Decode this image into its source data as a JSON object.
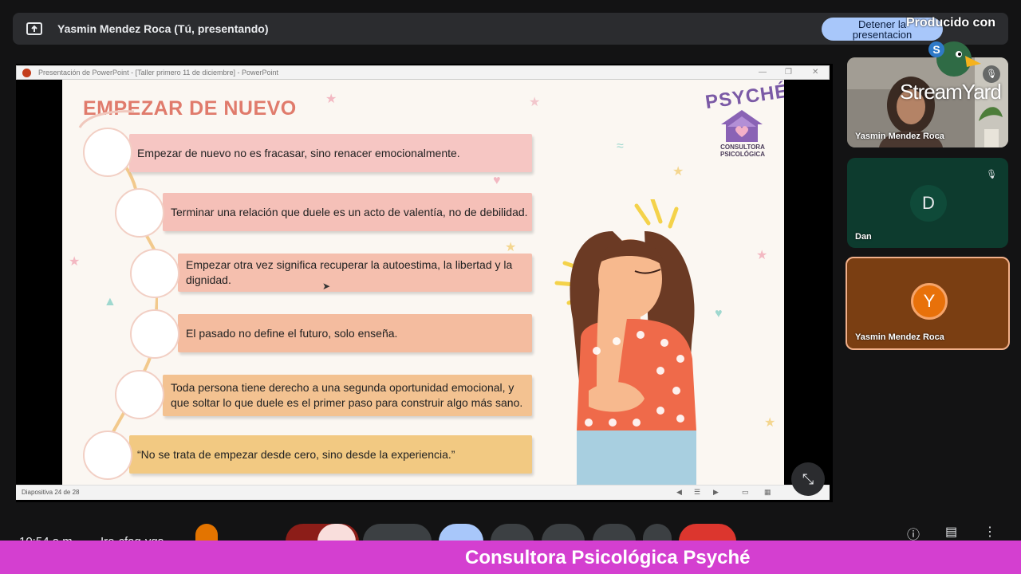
{
  "meet": {
    "presenting_title": "Yasmin Mendez Roca (Tú, presentando)",
    "stop_presenting_line1": "Detener la",
    "stop_presenting_line2": "presentacion",
    "meeting_code": "Iro-cfaq-yqs",
    "clock": "10:54 a.m."
  },
  "watermark": {
    "produced_with": "Producido con",
    "logo_text": "StreamYard"
  },
  "powerpoint": {
    "titlebar_text": "Presentación de PowerPoint - [Taller primero 11 de diciembre] - PowerPoint",
    "status_text": "Diapositiva 24 de 28"
  },
  "slide": {
    "title": "EMPEZAR DE NUEVO",
    "brand_name": "PSYCHÉ",
    "brand_subtitle_line1": "CONSULTORA",
    "brand_subtitle_line2": "PSICOLÓGICA",
    "items": [
      {
        "text": "Empezar de nuevo no es fracasar, sino renacer emocionalmente.",
        "color": "#f6c6c3"
      },
      {
        "text": "Terminar una relación que duele es un acto de valentía, no de debilidad.",
        "color": "#f5c0b8"
      },
      {
        "text": "Empezar otra vez significa recuperar la autoestima, la libertad y la dignidad.",
        "color": "#f5bfae"
      },
      {
        "text": "El pasado no define el futuro, solo enseña.",
        "color": "#f4bc9f"
      },
      {
        "text": "Toda persona tiene derecho a una segunda oportunidad emocional, y que soltar lo que duele es el primer paso para construir algo más sano.",
        "color": "#f3c291"
      },
      {
        "text": "“No se trata de empezar desde cero, sino desde la experiencia.”",
        "color": "#f2c982"
      }
    ]
  },
  "participants": [
    {
      "name": "Yasmin Mendez Roca",
      "initial": "",
      "kind": "camera"
    },
    {
      "name": "Dan",
      "initial": "D",
      "kind": "avatar"
    },
    {
      "name": "Yasmin Mendez Roca",
      "initial": "Y",
      "kind": "avatar"
    }
  ],
  "banner": {
    "text": "Consultora Psicológica Psyché"
  },
  "colors": {
    "accent_blue": "#a8c7fa",
    "banner_magenta": "#d43fd0",
    "slide_title": "#e07b6c",
    "brand_purple": "#7b5aa6"
  }
}
